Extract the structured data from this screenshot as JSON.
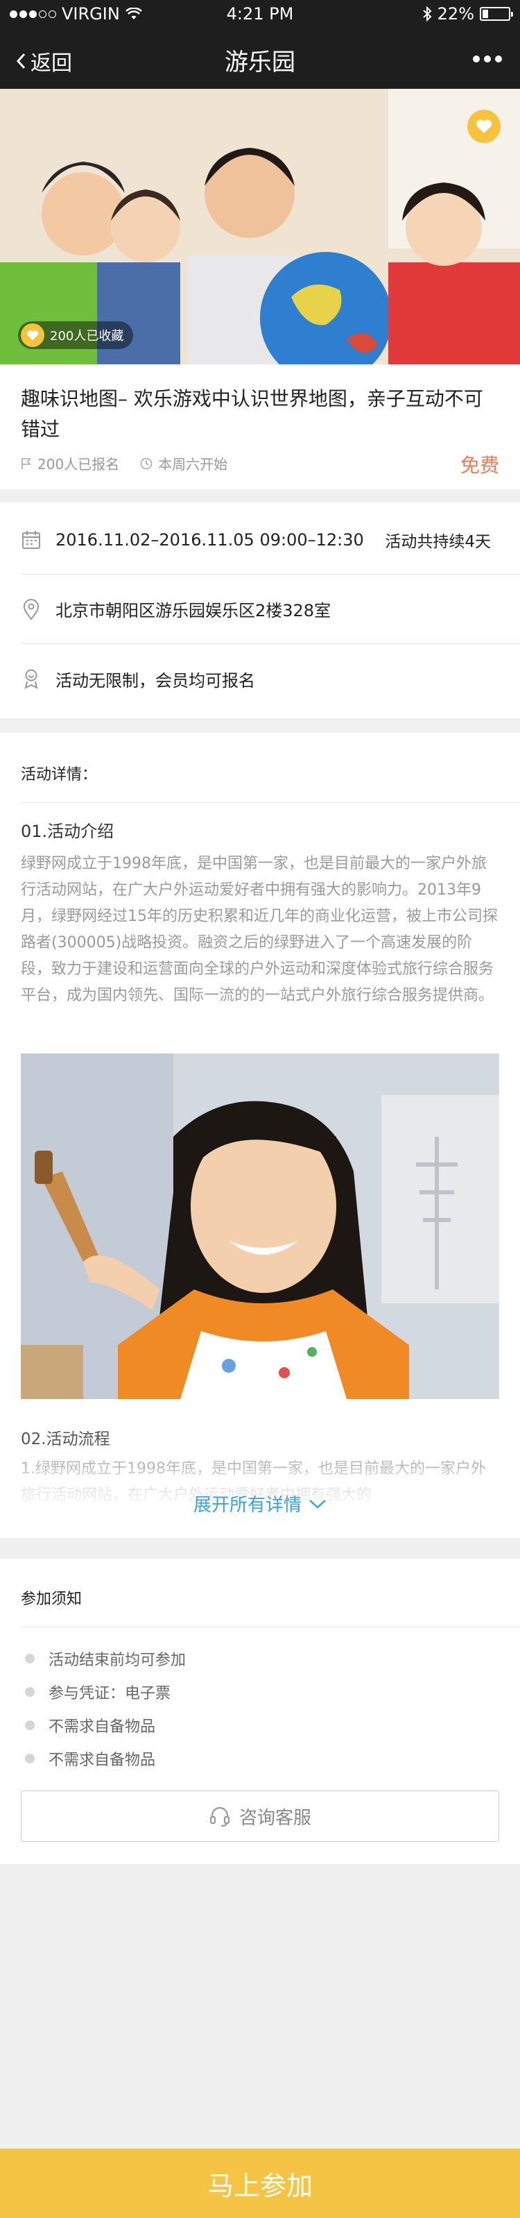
{
  "status": {
    "carrier": "VIRGIN",
    "time": "4:21 PM",
    "battery": "22%",
    "battery_level": 0.22
  },
  "nav": {
    "back_label": "返回",
    "title": "游乐园"
  },
  "hero": {
    "collect_count": "200人已收藏"
  },
  "event": {
    "title": "趣味识地图– 欢乐游戏中认识世界地图，亲子互动不可错过",
    "signups": "200人已报名",
    "start": "本周六开始",
    "price": "免费"
  },
  "info": {
    "date": "2016.11.02–2016.11.05  09:00–12:30",
    "duration": "活动共持续4天",
    "address": "北京市朝阳区游乐园娱乐区2楼328室",
    "restriction": "活动无限制，会员均可报名"
  },
  "detail": {
    "heading": "活动详情：",
    "section1_title": "01.活动介绍",
    "section1_text": "绿野网成立于1998年底，是中国第一家，也是目前最大的一家户外旅行活动网站，在广大户外运动爱好者中拥有强大的影响力。2013年9月，绿野网经过15年的历史积累和近几年的商业化运营，被上市公司探路者(300005)战略投资。融资之后的绿野进入了一个高速发展的阶段，致力于建设和运营面向全球的户外运动和深度体验式旅行综合服务平台，成为国内领先、国际一流的的一站式户外旅行综合服务提供商。",
    "section2_title": "02.活动流程",
    "section2_text": "1.绿野网成立于1998年底，是中国第一家，也是目前最大的一家户外旅行活动网站，在广大户外运动爱好者中拥有强大的",
    "expand_label": "展开所有详情"
  },
  "notice": {
    "heading": "参加须知",
    "items": [
      "活动结束前均可参加",
      "参与凭证：电子票",
      "不需求自备物品",
      "不需求自备物品"
    ],
    "consult_label": "咨询客服"
  },
  "cta": {
    "join_label": "马上参加"
  },
  "colors": {
    "accent": "#f5c445",
    "price": "#f0785a",
    "link": "#3aa0e0",
    "bar": "#1e1e1e"
  }
}
